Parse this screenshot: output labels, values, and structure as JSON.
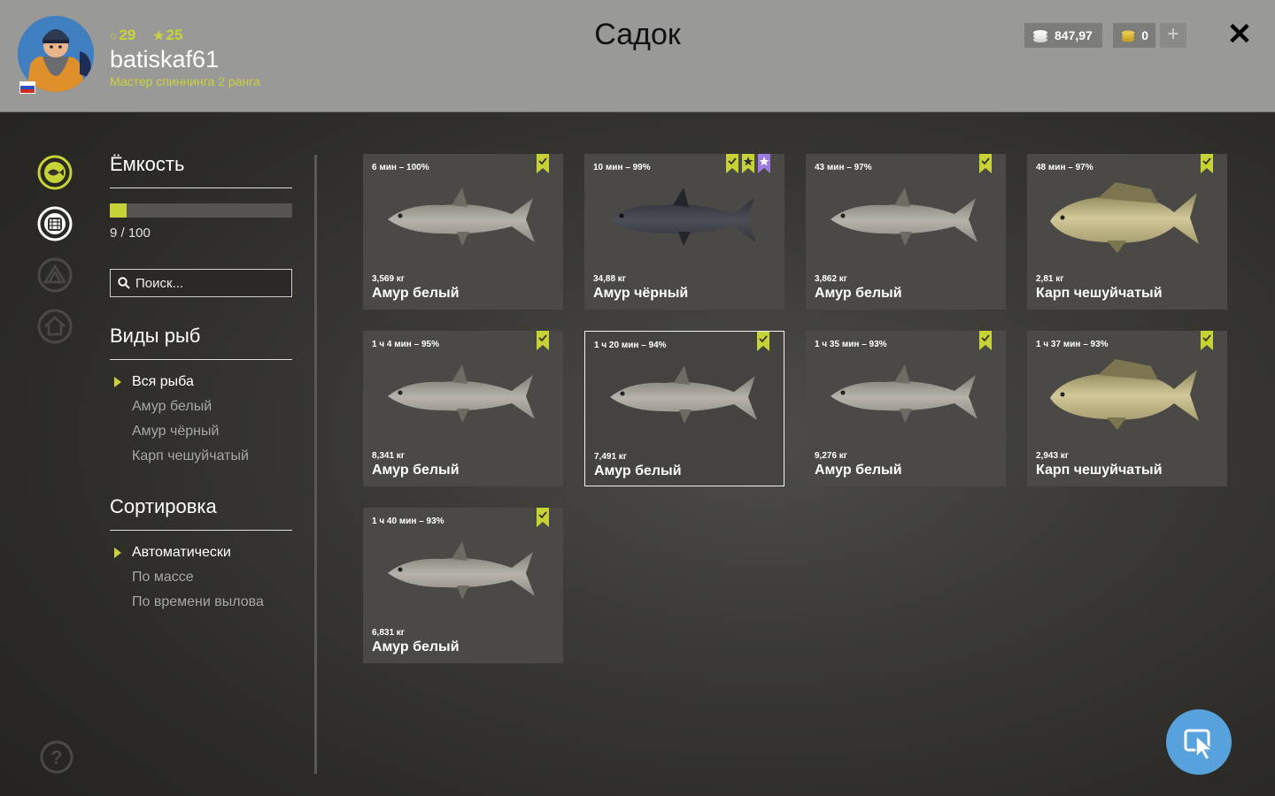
{
  "header": {
    "title": "Садок",
    "username": "batiskaf61",
    "rank": "Мастер спиннинга 2 ранга",
    "level": "29",
    "stars": "25",
    "silver": "847,97",
    "gold": "0",
    "add_label": "+",
    "close_label": "✕"
  },
  "colors": {
    "accent": "#c6d236",
    "purple": "#9d7ae0",
    "fab": "#57a2dc"
  },
  "sidebar": {
    "capacity_title": "Ёмкость",
    "capacity_text": "9 / 100",
    "capacity_fraction": 0.09,
    "search_placeholder": "Поиск...",
    "species_title": "Виды рыб",
    "species": [
      "Вся рыба",
      "Амур белый",
      "Амур чёрный",
      "Карп чешуйчатый"
    ],
    "sort_title": "Сортировка",
    "sort": [
      "Автоматически",
      "По массе",
      "По времени вылова"
    ]
  },
  "nav_icons": [
    "fish-icon",
    "keepnet-icon",
    "tent-icon",
    "house-icon"
  ],
  "cards": [
    {
      "time": "6 мин – 100%",
      "weight": "3,569 кг",
      "name": "Амур белый",
      "fish": "white",
      "badges": [
        "green"
      ]
    },
    {
      "time": "10 мин – 99%",
      "weight": "34,88 кг",
      "name": "Амур чёрный",
      "fish": "black",
      "badges": [
        "green",
        "star",
        "purple"
      ]
    },
    {
      "time": "43 мин – 97%",
      "weight": "3,862 кг",
      "name": "Амур белый",
      "fish": "white",
      "badges": [
        "green"
      ]
    },
    {
      "time": "48 мин – 97%",
      "weight": "2,81 кг",
      "name": "Карп чешуйчатый",
      "fish": "carp",
      "badges": [
        "green"
      ]
    },
    {
      "time": "1 ч 4 мин – 95%",
      "weight": "8,341 кг",
      "name": "Амур белый",
      "fish": "white",
      "badges": [
        "green"
      ]
    },
    {
      "time": "1 ч 20 мин – 94%",
      "weight": "7,491 кг",
      "name": "Амур белый",
      "fish": "white",
      "badges": [
        "green"
      ],
      "selected": true
    },
    {
      "time": "1 ч 35 мин – 93%",
      "weight": "9,276 кг",
      "name": "Амур белый",
      "fish": "white",
      "badges": [
        "green"
      ]
    },
    {
      "time": "1 ч 37 мин – 93%",
      "weight": "2,943 кг",
      "name": "Карп чешуйчатый",
      "fish": "carp",
      "badges": [
        "green"
      ]
    },
    {
      "time": "1 ч 40 мин – 93%",
      "weight": "6,831 кг",
      "name": "Амур белый",
      "fish": "white",
      "badges": [
        "green"
      ]
    }
  ]
}
